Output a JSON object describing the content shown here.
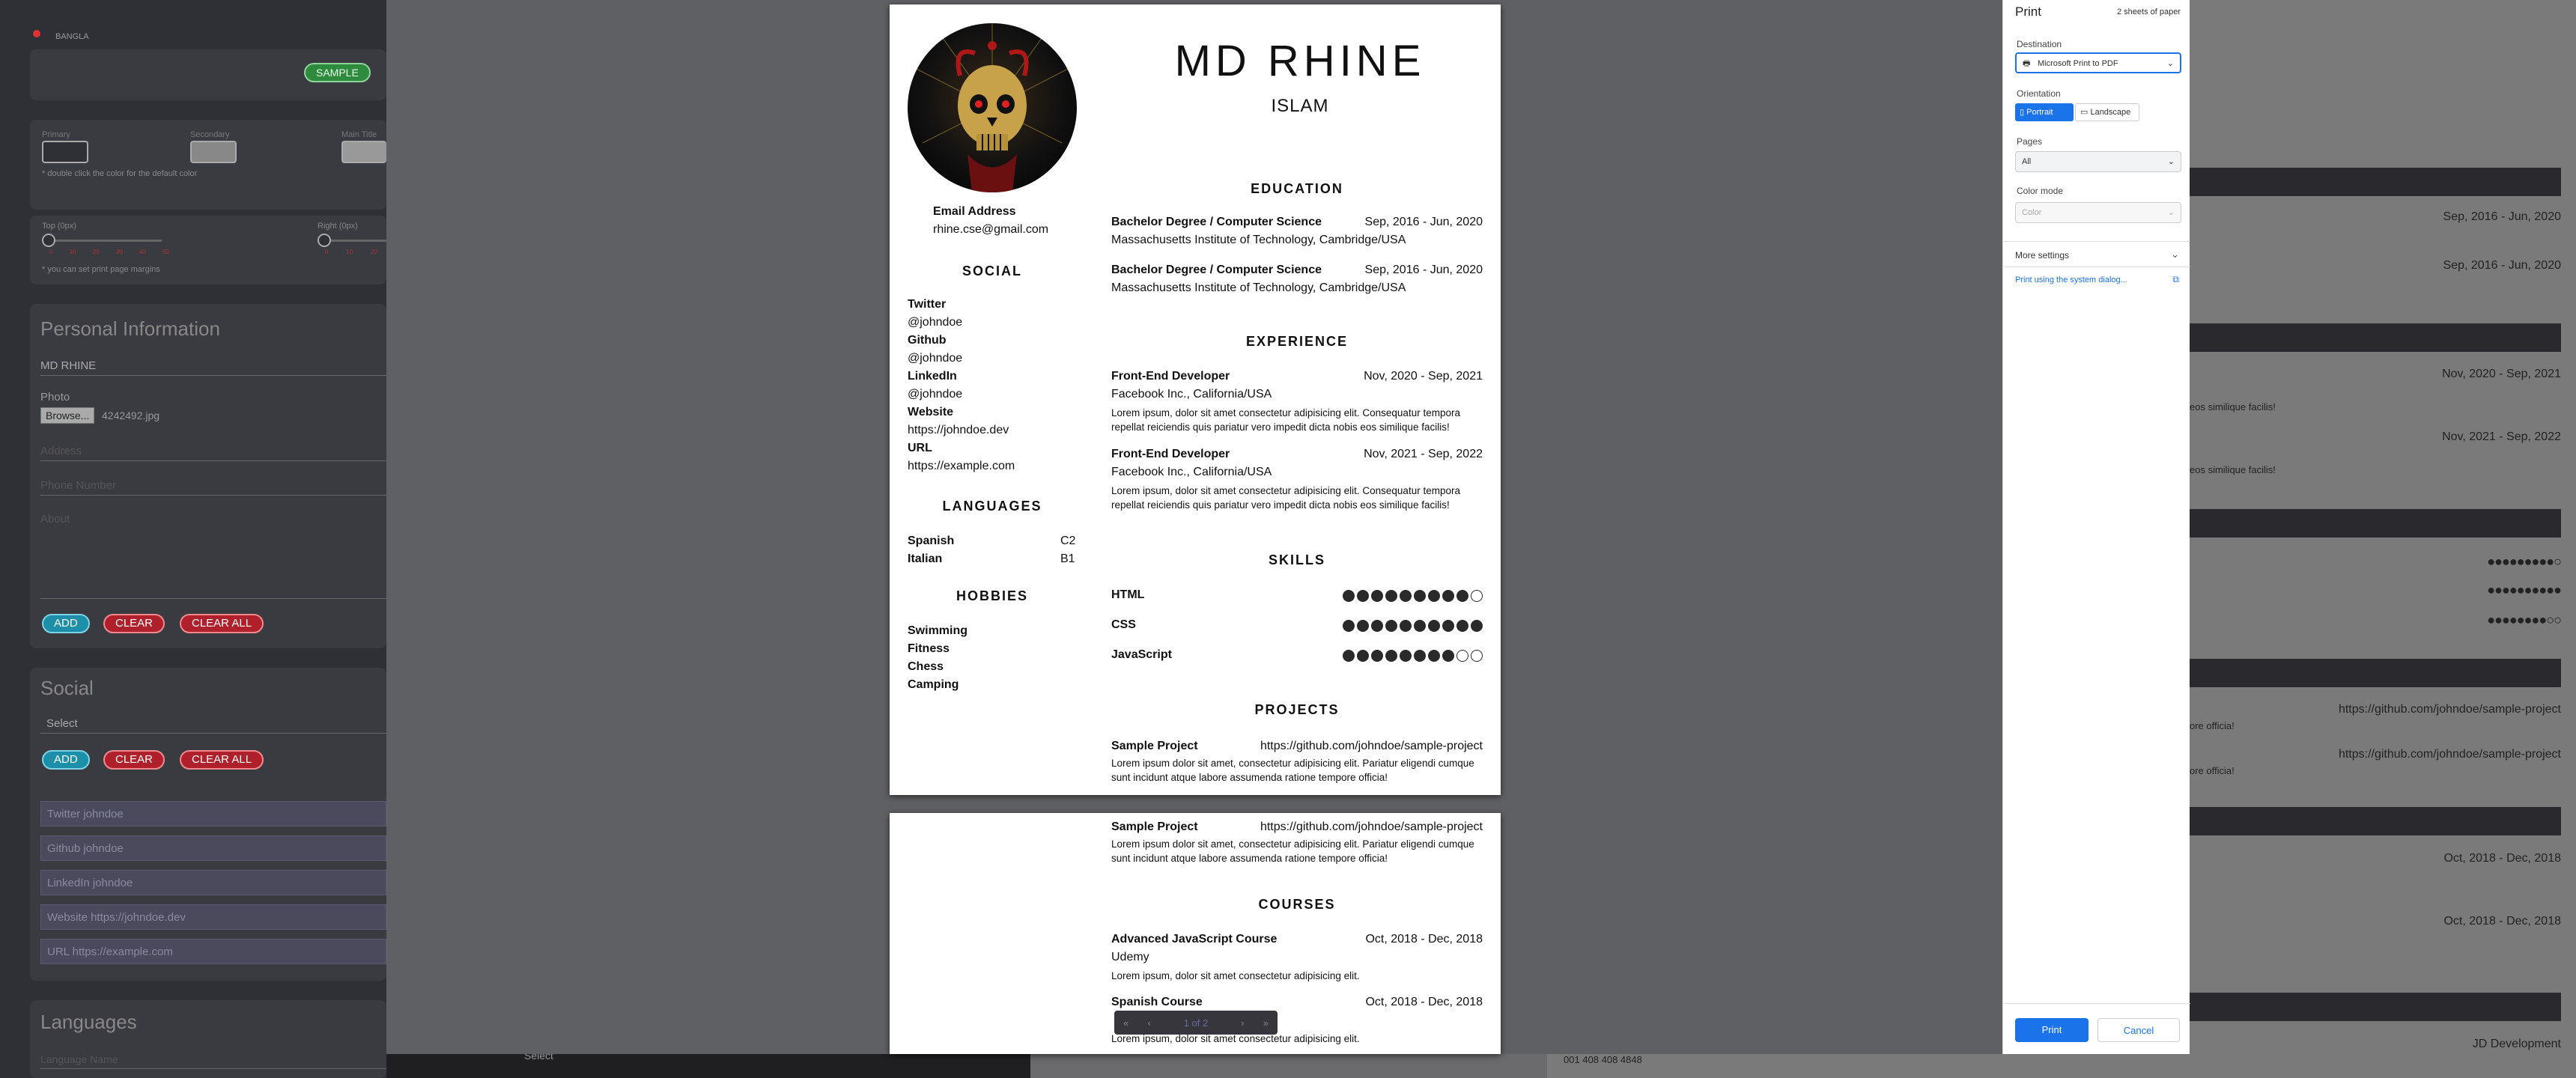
{
  "left_app": {
    "lang_toggle": "BANGLA",
    "sample_button": "SAMPLE",
    "colors": {
      "primary_label": "Primary",
      "secondary_label": "Secondary",
      "main_title_label": "Main Title",
      "hint": "* double click the color for the default color"
    },
    "margins": {
      "top_label": "Top (0px)",
      "right_label": "Right (0px)",
      "hint": "* you can set print page margins",
      "ticks_left": [
        "0",
        "10",
        "20",
        "30",
        "40",
        "50"
      ],
      "ticks_right": [
        "0",
        "10",
        "20"
      ]
    },
    "personal": {
      "title": "Personal Information",
      "name_value": "MD RHINE",
      "photo_label": "Photo",
      "browse": "Browse...",
      "photo_file": "4242492.jpg",
      "address_ph": "Address",
      "phone_ph": "Phone Number",
      "about_ph": "About",
      "add": "ADD",
      "clear": "CLEAR",
      "clear_all": "CLEAR ALL"
    },
    "social": {
      "title": "Social",
      "select": "Select",
      "add": "ADD",
      "clear": "CLEAR",
      "clear_all": "CLEAR ALL",
      "items": [
        "Twitter   johndoe",
        "Github   johndoe",
        "LinkedIn   johndoe",
        "Website   https://johndoe.dev",
        "URL   https://example.com"
      ]
    },
    "languages": {
      "title": "Languages",
      "name_ph": "Language Name",
      "select": "Select"
    }
  },
  "right_app": {
    "dates": [
      "Sep, 2016 - Jun, 2020",
      "Sep, 2016 - Jun, 2020",
      "Nov, 2020 - Sep, 2021",
      "Nov, 2021 - Sep, 2022"
    ],
    "frag1": "eos similique facilis!",
    "frag2": "eos similique facilis!",
    "links": [
      "https://github.com/johndoe/sample-project",
      "https://github.com/johndoe/sample-project"
    ],
    "frag3": "ore officia!",
    "frag4": "ore officia!",
    "course_dates": [
      "Oct, 2018 - Dec, 2018",
      "Oct, 2018 - Dec, 2018"
    ],
    "footer": "JD Development",
    "phone": "001 408 408 4848"
  },
  "resume": {
    "first_name": "MD RHINE",
    "last_name": "ISLAM",
    "email_label": "Email Address",
    "email": "rhine.cse@gmail.com",
    "social_title": "SOCIAL",
    "social": [
      {
        "k": "Twitter",
        "v": "@johndoe"
      },
      {
        "k": "Github",
        "v": "@johndoe"
      },
      {
        "k": "LinkedIn",
        "v": "@johndoe"
      },
      {
        "k": "Website",
        "v": "https://johndoe.dev"
      },
      {
        "k": "URL",
        "v": "https://example.com"
      }
    ],
    "languages_title": "LANGUAGES",
    "languages": [
      {
        "k": "Spanish",
        "v": "C2"
      },
      {
        "k": "Italian",
        "v": "B1"
      }
    ],
    "hobbies_title": "HOBBIES",
    "hobbies": [
      "Swimming",
      "Fitness",
      "Chess",
      "Camping"
    ],
    "education_title": "EDUCATION",
    "education": [
      {
        "degree": "Bachelor Degree / Computer Science",
        "date": "Sep, 2016 - Jun, 2020",
        "school": "Massachusetts Institute of Technology, Cambridge/USA"
      },
      {
        "degree": "Bachelor Degree / Computer Science",
        "date": "Sep, 2016 - Jun, 2020",
        "school": "Massachusetts Institute of Technology, Cambridge/USA"
      }
    ],
    "experience_title": "EXPERIENCE",
    "experience": [
      {
        "role": "Front-End Developer",
        "date": "Nov, 2020 - Sep, 2021",
        "company": "Facebook Inc., California/USA",
        "desc": "Lorem ipsum, dolor sit amet consectetur adipisicing elit. Consequatur tempora repellat reiciendis quis pariatur vero impedit dicta nobis eos similique facilis!"
      },
      {
        "role": "Front-End Developer",
        "date": "Nov, 2021 - Sep, 2022",
        "company": "Facebook Inc., California/USA",
        "desc": "Lorem ipsum, dolor sit amet consectetur adipisicing elit. Consequatur tempora repellat reiciendis quis pariatur vero impedit dicta nobis eos similique facilis!"
      }
    ],
    "skills_title": "SKILLS",
    "skills": [
      {
        "name": "HTML",
        "level": 9,
        "max": 10
      },
      {
        "name": "CSS",
        "level": 10,
        "max": 10
      },
      {
        "name": "JavaScript",
        "level": 8,
        "max": 10
      }
    ],
    "projects_title": "PROJECTS",
    "projects": [
      {
        "name": "Sample Project",
        "url": "https://github.com/johndoe/sample-project",
        "desc": "Lorem ipsum dolor sit amet, consectetur adipisicing elit. Pariatur eligendi cumque sunt incidunt atque labore assumenda ratione tempore officia!"
      }
    ],
    "courses_title": "COURSES",
    "courses": [
      {
        "name": "Advanced JavaScript Course",
        "date": "Oct, 2018 - Dec, 2018",
        "org": "Udemy",
        "desc": "Lorem ipsum, dolor sit amet consectetur adipisicing elit."
      },
      {
        "name": "Spanish Course",
        "date": "Oct, 2018 - Dec, 2018",
        "desc": "Lorem ipsum, dolor sit amet consectetur adipisicing elit."
      }
    ]
  },
  "pager": {
    "first": "«",
    "prev": "‹",
    "page": "1 of 2",
    "next": "›",
    "last": "»"
  },
  "print_dialog": {
    "title": "Print",
    "sheets": "2 sheets of paper",
    "destination_label": "Destination",
    "destination": "Microsoft Print to PDF",
    "orientation_label": "Orientation",
    "portrait": "Portrait",
    "landscape": "Landscape",
    "pages_label": "Pages",
    "pages": "All",
    "color_label": "Color mode",
    "color": "Color",
    "more_settings": "More settings",
    "system_dialog": "Print using the system dialog...",
    "print": "Print",
    "cancel": "Cancel",
    "accent": "#1a73e8"
  }
}
